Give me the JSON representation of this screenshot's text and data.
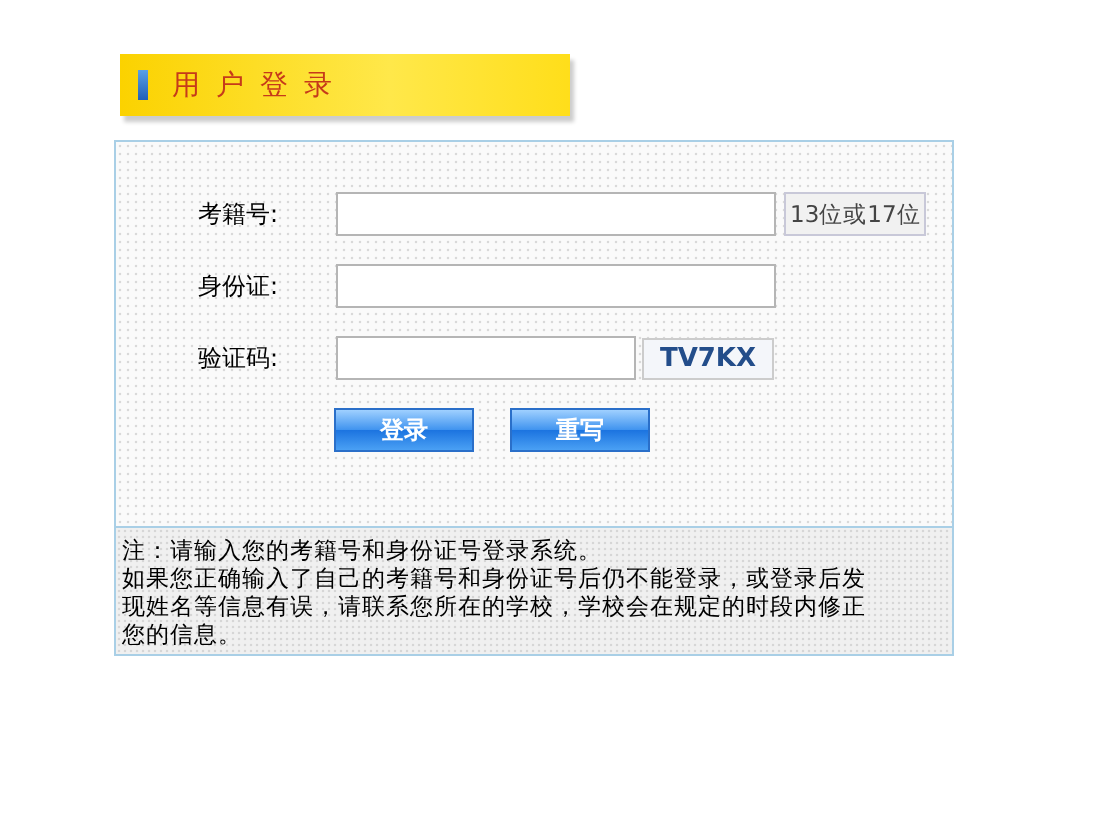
{
  "header": {
    "title": "用户登录"
  },
  "fields": [
    {
      "label": "考籍号:",
      "kind": "text",
      "hint": "13位或17位"
    },
    {
      "label": "身份证:",
      "kind": "text"
    },
    {
      "label": "验证码:",
      "kind": "captcha",
      "code": "TV7KX"
    }
  ],
  "buttons": [
    "登录",
    "重写"
  ],
  "notes": [
    "注：请输入您的考籍号和身份证号登录系统。",
    "如果您正确输入了自己的考籍号和身份证号后仍不能登录，或登录后发现姓名等信息有误，请联系您所在的学校，学校会在规定的时段内修正您的信息。"
  ]
}
